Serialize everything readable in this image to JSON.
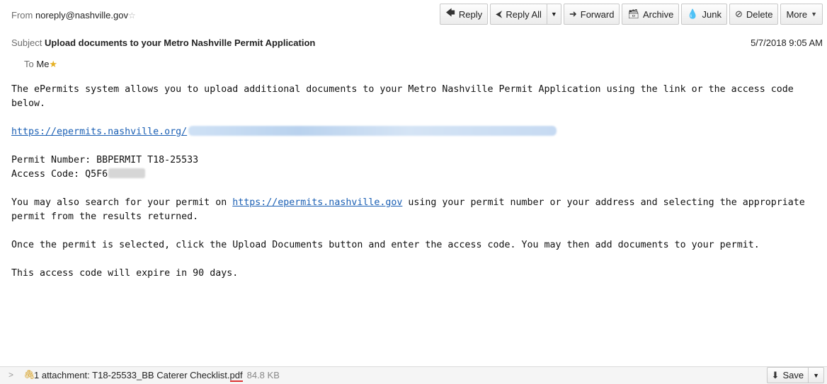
{
  "header": {
    "from_label": "From",
    "from_value": "noreply@nashville.gov",
    "subject_label": "Subject",
    "subject_value": "Upload documents to your Metro Nashville Permit Application",
    "to_label": "To",
    "to_value": "Me",
    "date": "5/7/2018 9:05 AM"
  },
  "toolbar": {
    "reply": "Reply",
    "reply_all": "Reply All",
    "forward": "Forward",
    "archive": "Archive",
    "junk": "Junk",
    "delete": "Delete",
    "more": "More"
  },
  "body": {
    "p1": "The ePermits system allows you to upload additional documents to your Metro Nashville Permit Application using the link or the access code below.",
    "link1": "https://epermits.nashville.org/",
    "permit_line": "Permit Number:  BBPERMIT T18-25533",
    "access_label": "Access Code:  Q5F6",
    "p3_before": "You may also search for your permit on ",
    "p3_link": "https://epermits.nashville.gov",
    "p3_after": " using your permit number or your address and selecting the appropriate permit from the results returned.",
    "p4": "Once the permit is selected, click the Upload Documents button and enter the access code.  You may then add documents to your permit.",
    "p5": "This access code will expire in 90 days."
  },
  "attachment": {
    "text_prefix": "1 attachment: T18-25533_BB Caterer Checklist.",
    "text_ext": "pdf",
    "size": "84.8 KB",
    "save": "Save"
  },
  "icons": {
    "reply": "reply-icon",
    "reply_all": "reply-all-icon",
    "forward": "forward-icon",
    "archive": "archive-icon",
    "junk": "junk-icon",
    "delete": "delete-icon",
    "save": "download-icon",
    "attachment": "paperclip-icon"
  }
}
